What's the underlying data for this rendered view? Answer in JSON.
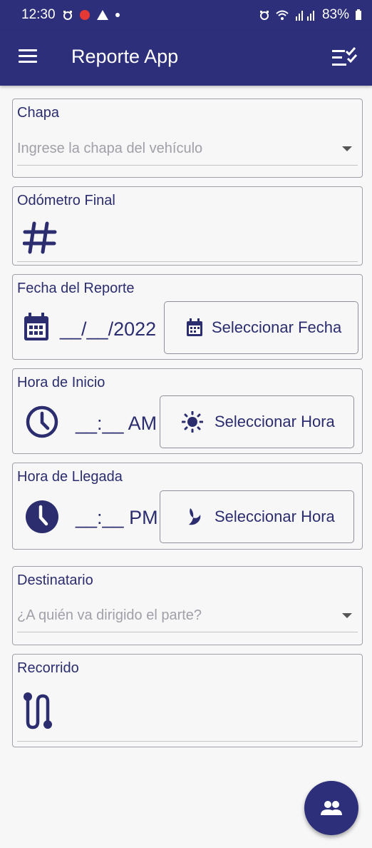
{
  "status_bar": {
    "time": "12:30",
    "battery": "83%"
  },
  "app_bar": {
    "title": "Reporte App"
  },
  "form": {
    "chapa": {
      "label": "Chapa",
      "placeholder": "Ingrese la chapa del vehículo"
    },
    "odometro": {
      "label": "Odómetro Final"
    },
    "fecha": {
      "label": "Fecha del Reporte",
      "value": "__/__/2022",
      "button_label": "Seleccionar Fecha"
    },
    "hora_inicio": {
      "label": "Hora de Inicio",
      "value": "__:__ AM",
      "button_label": "Seleccionar Hora"
    },
    "hora_llegada": {
      "label": "Hora de Llegada",
      "value": "__:__ PM",
      "button_label": "Seleccionar Hora"
    },
    "destinatario": {
      "label": "Destinatario",
      "placeholder": "¿A quién va dirigido el parte?"
    },
    "recorrido": {
      "label": "Recorrido"
    }
  },
  "colors": {
    "primary": "#2d2f7a",
    "text": "#2b2d6e",
    "placeholder": "#a0a0a8",
    "border": "#9ea0a8",
    "background": "#f7f7f8"
  },
  "icons": {
    "menu": "menu-icon",
    "checklist": "checklist-icon",
    "odometer": "hash-icon",
    "date": "calendar-icon",
    "start_time": "clock-outline-icon",
    "sun": "sun-icon",
    "end_time": "clock-filled-icon",
    "moon": "moon-icon",
    "route": "route-icon",
    "contacts": "group-icon"
  }
}
